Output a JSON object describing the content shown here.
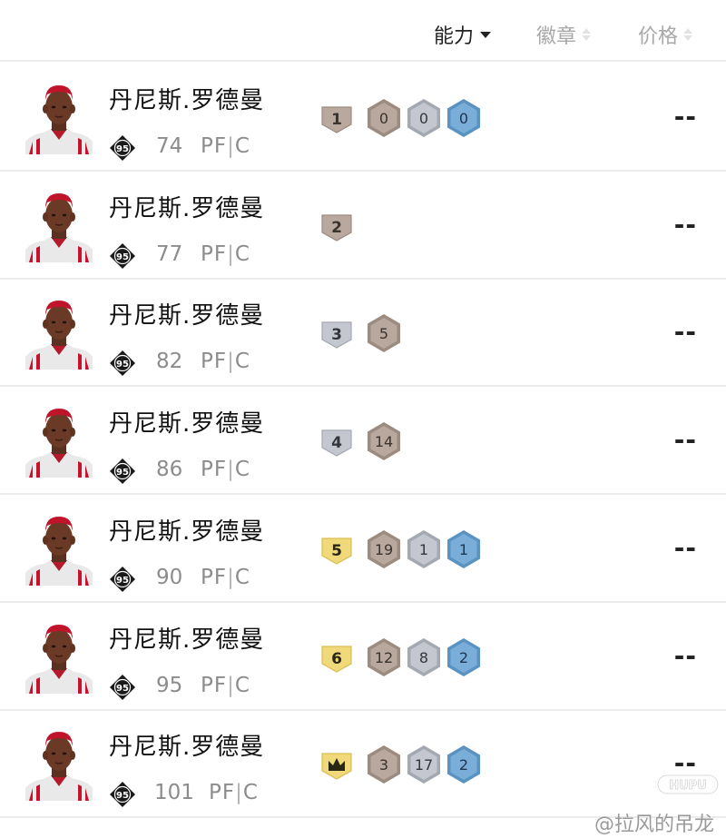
{
  "header": {
    "ability": {
      "label": "能力",
      "icon": "caret-down-icon"
    },
    "badges": {
      "label": "徽章",
      "icon": "sort-icon"
    },
    "price": {
      "label": "价格",
      "icon": "sort-icon"
    }
  },
  "colors": {
    "bronze": "#b8a89d",
    "silver": "#c4c7cf",
    "gold": "#f0d97a",
    "hof": "#7aaed8"
  },
  "cards": [
    {
      "name": "丹尼斯.罗德曼",
      "tier": "95",
      "rating": "74",
      "pos1": "PF",
      "pos2": "C",
      "evo_label": "1",
      "evo_color": "bronze",
      "badges": [
        "0",
        "0",
        "0"
      ],
      "badge_colors": [
        "bronze",
        "silver",
        "hof"
      ],
      "price": "--"
    },
    {
      "name": "丹尼斯.罗德曼",
      "tier": "95",
      "rating": "77",
      "pos1": "PF",
      "pos2": "C",
      "evo_label": "2",
      "evo_color": "bronze",
      "badges": [],
      "badge_colors": [],
      "price": "--"
    },
    {
      "name": "丹尼斯.罗德曼",
      "tier": "95",
      "rating": "82",
      "pos1": "PF",
      "pos2": "C",
      "evo_label": "3",
      "evo_color": "silver",
      "badges": [
        "5"
      ],
      "badge_colors": [
        "bronze"
      ],
      "price": "--"
    },
    {
      "name": "丹尼斯.罗德曼",
      "tier": "95",
      "rating": "86",
      "pos1": "PF",
      "pos2": "C",
      "evo_label": "4",
      "evo_color": "silver",
      "badges": [
        "14"
      ],
      "badge_colors": [
        "bronze"
      ],
      "price": "--"
    },
    {
      "name": "丹尼斯.罗德曼",
      "tier": "95",
      "rating": "90",
      "pos1": "PF",
      "pos2": "C",
      "evo_label": "5",
      "evo_color": "gold",
      "badges": [
        "19",
        "1",
        "1"
      ],
      "badge_colors": [
        "bronze",
        "silver",
        "hof"
      ],
      "price": "--"
    },
    {
      "name": "丹尼斯.罗德曼",
      "tier": "95",
      "rating": "95",
      "pos1": "PF",
      "pos2": "C",
      "evo_label": "6",
      "evo_color": "gold",
      "badges": [
        "12",
        "8",
        "2"
      ],
      "badge_colors": [
        "bronze",
        "silver",
        "hof"
      ],
      "price": "--"
    },
    {
      "name": "丹尼斯.罗德曼",
      "tier": "95",
      "rating": "101",
      "pos1": "PF",
      "pos2": "C",
      "evo_label": "",
      "evo_icon": "crown-icon",
      "evo_color": "gold",
      "badges": [
        "3",
        "17",
        "2"
      ],
      "badge_colors": [
        "bronze",
        "silver",
        "hof"
      ],
      "price": "--"
    }
  ],
  "watermark": {
    "logo": "HUPU",
    "text": "@拉风的吊龙"
  }
}
